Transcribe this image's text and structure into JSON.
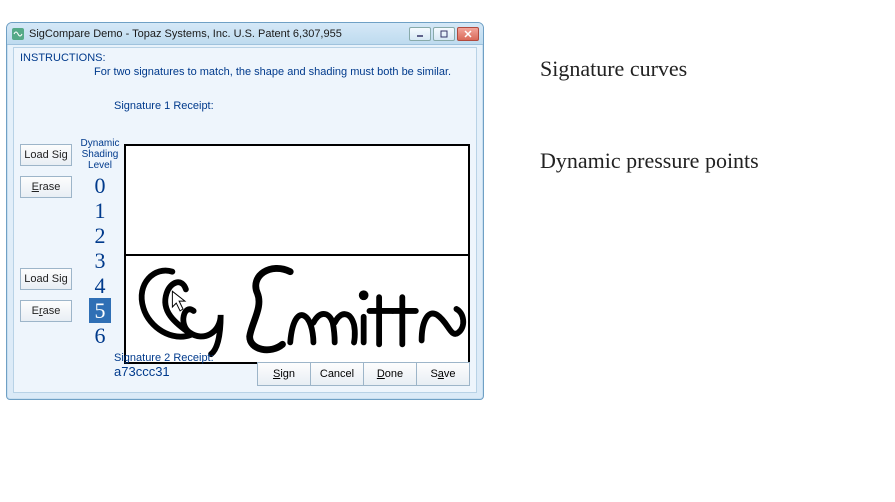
{
  "window": {
    "title": "SigCompare Demo - Topaz Systems, Inc.  U.S. Patent 6,307,955"
  },
  "instructions": {
    "label": "INSTRUCTIONS:",
    "text": "For two signatures to match, the shape and shading must both be similar."
  },
  "signature1": {
    "label": "Signature 1 Receipt:"
  },
  "signature2": {
    "label": "Signature 2 Receipt:",
    "value": "a73ccc31"
  },
  "side_buttons": {
    "load1": "Load Sig",
    "erase1": "Erase",
    "load2": "Load Sig",
    "erase2": "Erase"
  },
  "shading": {
    "header1": "Dynamic",
    "header2": "Shading",
    "header3": "Level",
    "levels": [
      "0",
      "1",
      "2",
      "3",
      "4",
      "5",
      "6"
    ],
    "selected": "5"
  },
  "actions": {
    "sign": "Sign",
    "cancel": "Cancel",
    "done": "Done",
    "save": "Save"
  },
  "annotations": {
    "a1": "Signature curves",
    "a2": "Dynamic pressure points"
  }
}
